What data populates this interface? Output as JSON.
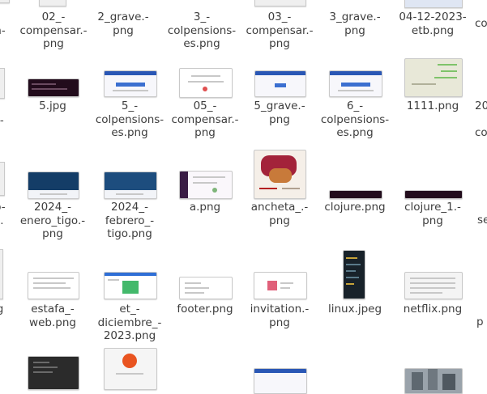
{
  "window": {
    "title": ""
  },
  "files": {
    "r0": [
      "n-",
      "02_-\ncompensar.-\npng",
      "2_grave.-\npng",
      "3_-\ncolpensions-\nes.png",
      "03_-\ncompensar.-\npng",
      "3_grave.-\npng",
      "04-12-2023-\netb.png",
      "co"
    ],
    "r1": [
      "r.-",
      "5.jpg",
      "5_-\ncolpensions-\nes.png",
      "05_-\ncompensar.-\npng",
      "5_grave.-\npng",
      "6_-\ncolpensions-\nes.png",
      "1111.png",
      "20\n\nco"
    ],
    "r2": [
      "o-\n-.",
      "2024_-\nenero_tigo.-\npng",
      "2024_-\nfebrero_-\ntigo.png",
      "a.png",
      "ancheta_.-\npng",
      "clojure.png",
      "clojure_1.-\npng",
      "se"
    ],
    "r3": [
      "g",
      "estafa_-\nweb.png",
      "et_-\ndiciembre_-\n2023.png",
      "footer.png",
      "invitation.-\npng",
      "linux.jpeg",
      "netflix.png",
      "p"
    ]
  },
  "colors": {
    "label": "#3d3d3d",
    "thumb_border": "#c9c9c9",
    "background": "#ffffff"
  }
}
